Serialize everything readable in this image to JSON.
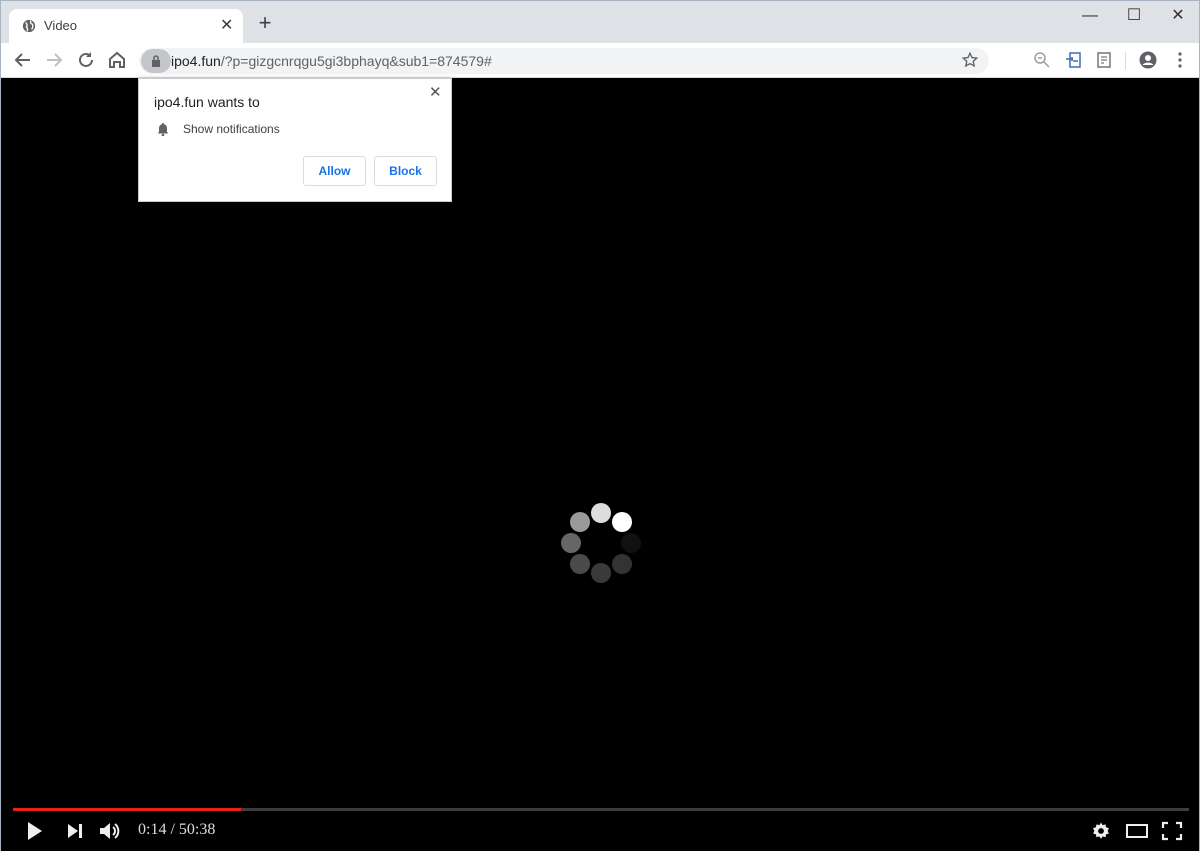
{
  "browser": {
    "tab": {
      "title": "Video",
      "icon": "globe-icon"
    },
    "new_tab_label": "+",
    "window_controls": {
      "minimize": "—",
      "maximize": "☐",
      "close": "✕"
    },
    "address": {
      "host": "ipo4.fun",
      "path": "/?p=gizgcnrqgu5gi3bphayq&sub1=874579#"
    },
    "toolbar_icons": [
      "back-icon",
      "forward-icon",
      "reload-icon",
      "home-icon",
      "lock-icon",
      "bookmark-star-icon",
      "zoom-icon",
      "extension-icon",
      "reading-list-icon",
      "profile-icon",
      "menu-icon"
    ]
  },
  "permission_popup": {
    "title": "ipo4.fun wants to",
    "permission": "Show notifications",
    "allow_label": "Allow",
    "block_label": "Block",
    "close_label": "✕"
  },
  "player": {
    "progress_percent": 19.4,
    "current_time": "0:14",
    "duration": "50:38",
    "time_display": "0:14 / 50:38",
    "loading": true,
    "colors": {
      "progress": "#e62117",
      "track": "#3d3d3d"
    }
  }
}
